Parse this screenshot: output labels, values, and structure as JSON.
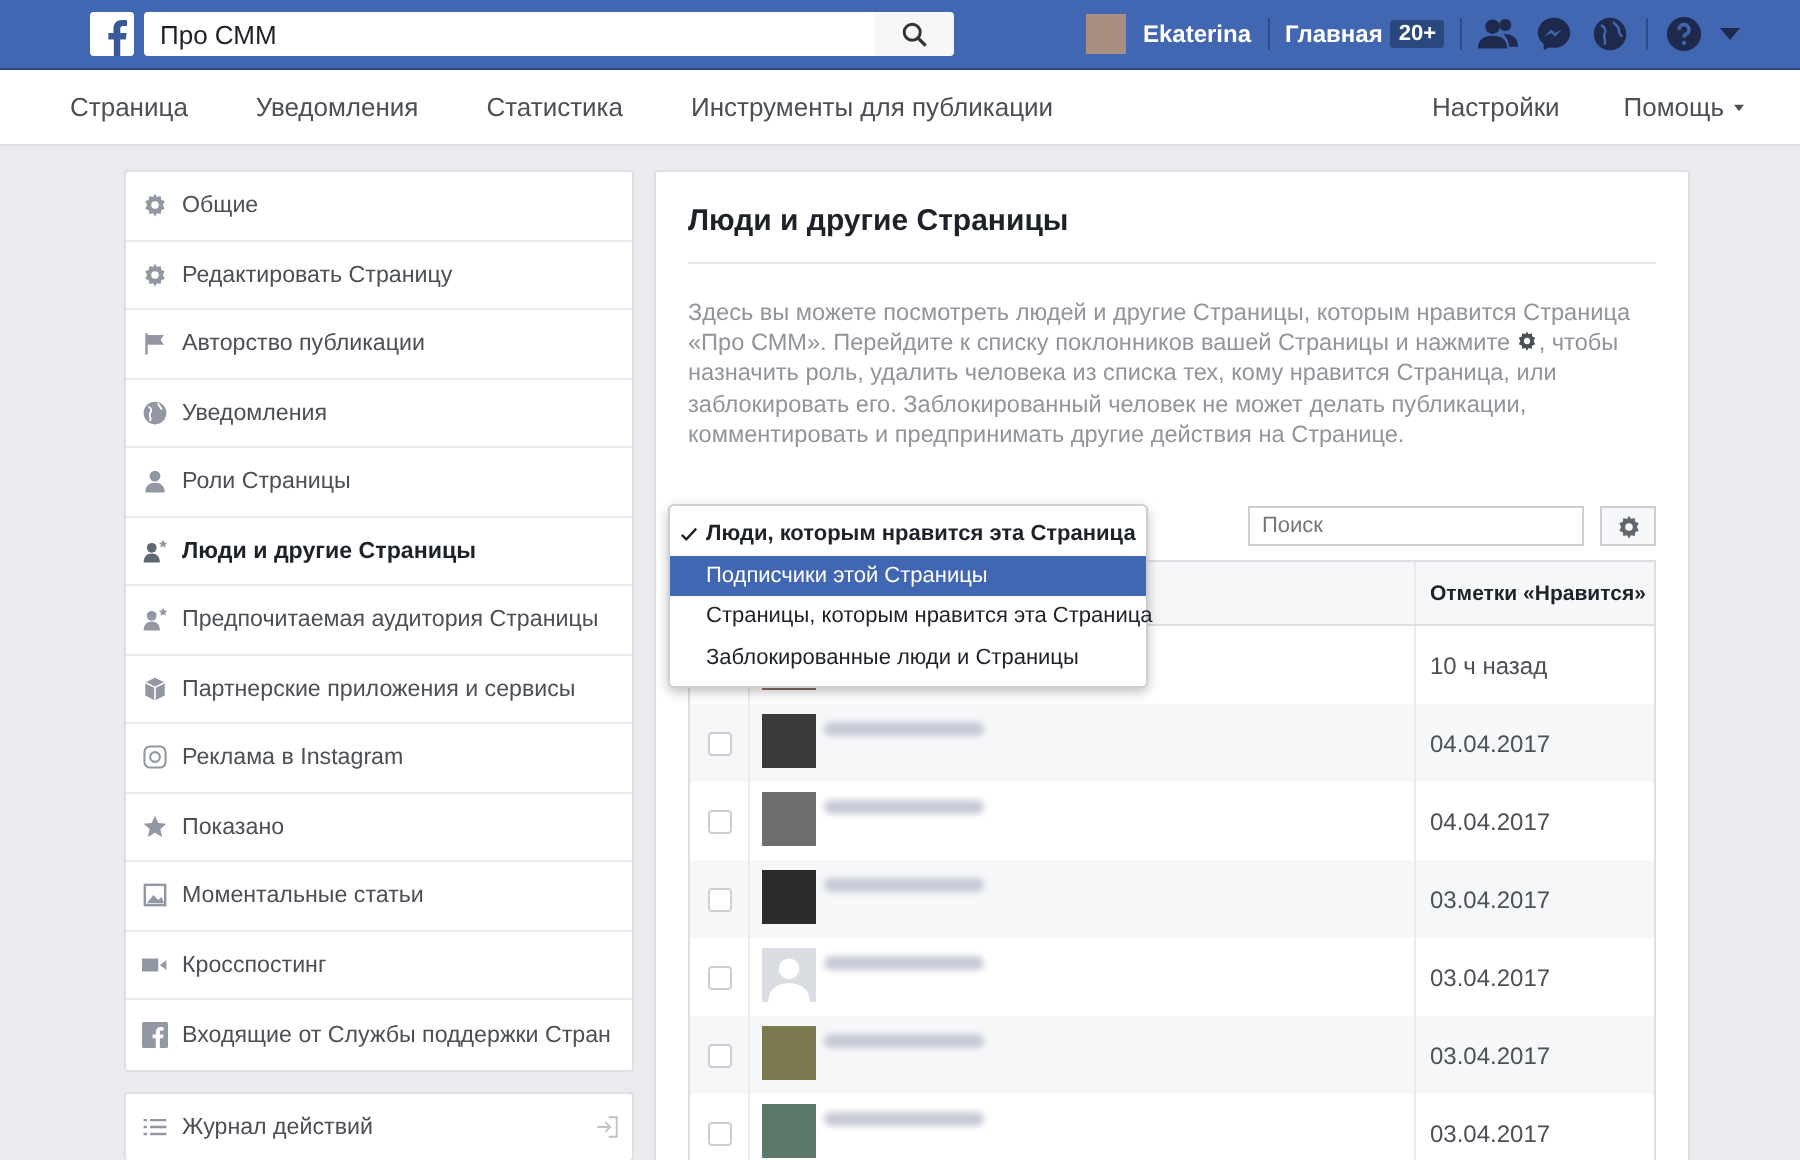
{
  "topbar": {
    "search": {
      "value": "Про СММ"
    },
    "user": {
      "name": "Ekaterina"
    },
    "home": {
      "label": "Главная",
      "badge": "20+"
    }
  },
  "page_nav": {
    "left": [
      {
        "label": "Страница"
      },
      {
        "label": "Уведомления"
      },
      {
        "label": "Статистика"
      },
      {
        "label": "Инструменты для публикации"
      }
    ],
    "right": [
      {
        "label": "Настройки",
        "dropdown": false
      },
      {
        "label": "Помощь",
        "dropdown": true
      }
    ]
  },
  "sidebar": {
    "items": [
      {
        "label": "Общие",
        "kind": "gear",
        "selected": false
      },
      {
        "label": "Редактировать Страницу",
        "kind": "gear",
        "selected": false
      },
      {
        "label": "Авторство публикации",
        "kind": "flag",
        "selected": false
      },
      {
        "label": "Уведомления",
        "kind": "globe",
        "selected": false
      },
      {
        "label": "Роли Страницы",
        "kind": "person",
        "selected": false
      },
      {
        "label": "Люди и другие Страницы",
        "kind": "person-star",
        "selected": true
      },
      {
        "label": "Предпочитаемая аудитория Страницы",
        "kind": "person-star",
        "selected": false
      },
      {
        "label": "Партнерские приложения и сервисы",
        "kind": "cube",
        "selected": false
      },
      {
        "label": "Реклама в Instagram",
        "kind": "camera",
        "selected": false
      },
      {
        "label": "Показано",
        "kind": "star",
        "selected": false
      },
      {
        "label": "Моментальные статьи",
        "kind": "image",
        "selected": false
      },
      {
        "label": "Кросспостинг",
        "kind": "video",
        "selected": false
      },
      {
        "label": "Входящие от Службы поддержки Стран",
        "kind": "f",
        "selected": false
      }
    ],
    "activity_log": {
      "label": "Журнал действий"
    }
  },
  "main": {
    "title": "Люди и другие Страницы",
    "description_before": "Здесь вы можете посмотреть людей и другие Страницы, которым нравится Страница «Про СММ». Перейдите к списку поклонников вашей Страницы и нажмите",
    "description_after": ", чтобы назначить роль, удалить человека из списка тех, кому нравится Страница, или заблокировать его. Заблокированный человек не может делать публикации, комментировать и предпринимать другие действия на Странице.",
    "search": {
      "placeholder": "Поиск"
    },
    "dropdown": {
      "options": [
        {
          "label": "Люди, которым нравится эта Страница",
          "selected": true,
          "highlighted": false
        },
        {
          "label": "Подписчики этой Страницы",
          "selected": false,
          "highlighted": true
        },
        {
          "label": "Страницы, которым нравится эта Страница",
          "selected": false,
          "highlighted": false
        },
        {
          "label": "Заблокированные люди и Страницы",
          "selected": false,
          "highlighted": false
        }
      ]
    },
    "table": {
      "columns": [
        {
          "label": "Отметки «Нравится»"
        }
      ],
      "rows": [
        {
          "kind": "photo",
          "liked": "10 ч назад"
        },
        {
          "kind": "photo",
          "checked": false,
          "liked": "04.04.2017"
        },
        {
          "kind": "photo",
          "checked": false,
          "liked": "04.04.2017"
        },
        {
          "kind": "photo",
          "checked": false,
          "liked": "03.04.2017"
        },
        {
          "kind": "silhouette",
          "checked": false,
          "liked": "03.04.2017"
        },
        {
          "kind": "photo",
          "checked": false,
          "liked": "03.04.2017"
        },
        {
          "kind": "photo",
          "checked": false,
          "liked": "03.04.2017"
        }
      ]
    }
  }
}
